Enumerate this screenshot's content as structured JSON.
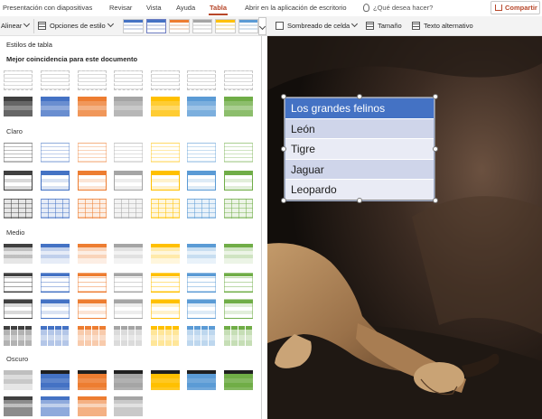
{
  "menu": {
    "tabs": [
      "Presentación con diapositivas",
      "Revisar",
      "Vista",
      "Ayuda",
      "Tabla"
    ],
    "active_tab": "Tabla",
    "open_desktop": "Abrir en la aplicación de escritorio",
    "search_placeholder": "¿Qué desea hacer?",
    "share_label": "Compartir"
  },
  "ribbon": {
    "align_label": "Alinear",
    "style_options_label": "Opciones de estilo",
    "cell_shading_label": "Sombreado de celda",
    "size_label": "Tamaño",
    "alt_text_label": "Texto alternativo",
    "gallery_colors": [
      "#4472c4",
      "#4472c4",
      "#ed7d31",
      "#a5a5a5",
      "#ffc000",
      "#5b9bd5"
    ]
  },
  "panel": {
    "title": "Estilos de tabla",
    "best_match": "Mejor coincidencia para este documento",
    "sections": [
      "Claro",
      "Medio",
      "Oscuro"
    ],
    "palette": [
      "#404040",
      "#4472c4",
      "#ed7d31",
      "#a5a5a5",
      "#ffc000",
      "#5b9bd5",
      "#70ad47"
    ]
  },
  "slide": {
    "table_rows": [
      "Los grandes felinos",
      "León",
      "Tigre",
      "Jaguar",
      "Leopardo"
    ]
  }
}
